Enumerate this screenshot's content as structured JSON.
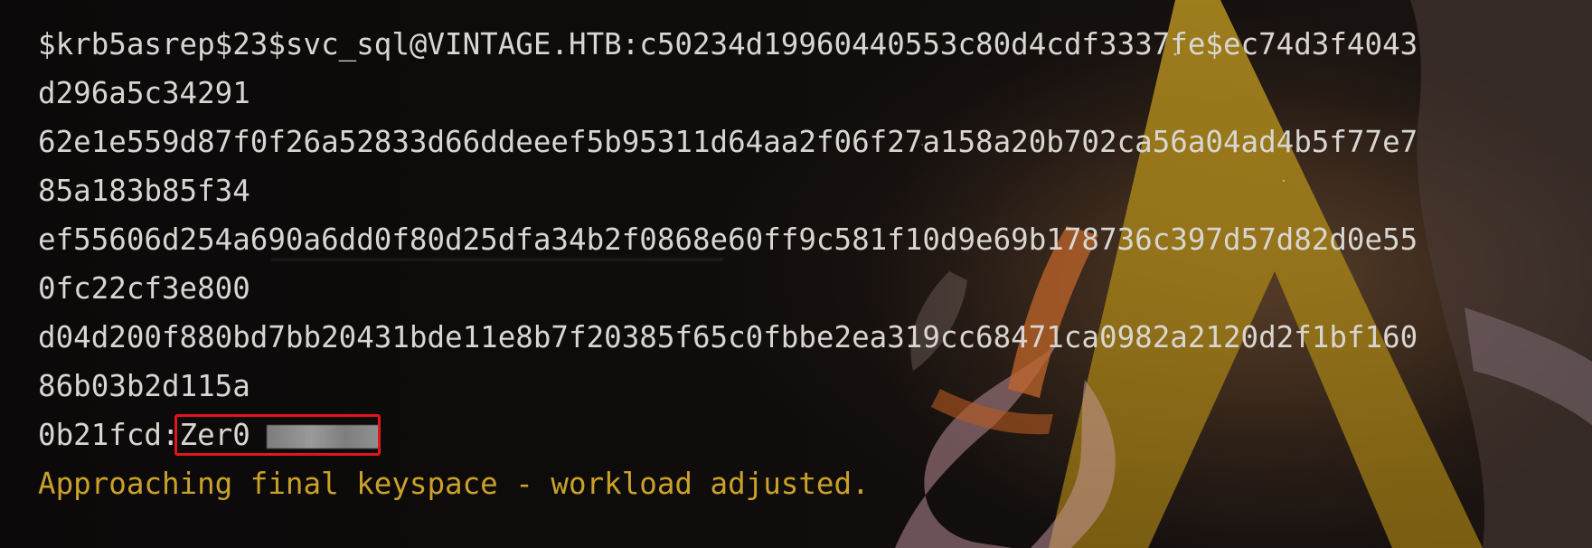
{
  "terminal": {
    "lines": [
      "$krb5asrep$23$svc_sql@VINTAGE.HTB:c50234d19960440553c80d4cdf3337fe$ec74d3f4043",
      "d296a5c34291",
      "62e1e559d87f0f26a52833d66ddeeef5b95311d64aa2f06f27a158a20b702ca56a04ad4b5f77e7",
      "85a183b85f34",
      "ef55606d254a690a6dd0f80d25dfa34b2f0868e60ff9c581f10d9e69b178736c397d57d82d0e55",
      "0fc22cf3e800",
      "d04d200f880bd7bb20431bde11e8b7f20385f65c0fbbe2ea319cc68471ca0982a2120d2f1bf160",
      "86b03b2d115a"
    ],
    "result_prefix": "0b21fcd:",
    "result_password_visible": "Zer0",
    "status_message": "Approaching final keyspace - workload adjusted."
  },
  "colors": {
    "text": "#d9d6d2",
    "warning": "#caa129",
    "highlight_box": "#e0161b",
    "background": "#0c0a0a"
  }
}
